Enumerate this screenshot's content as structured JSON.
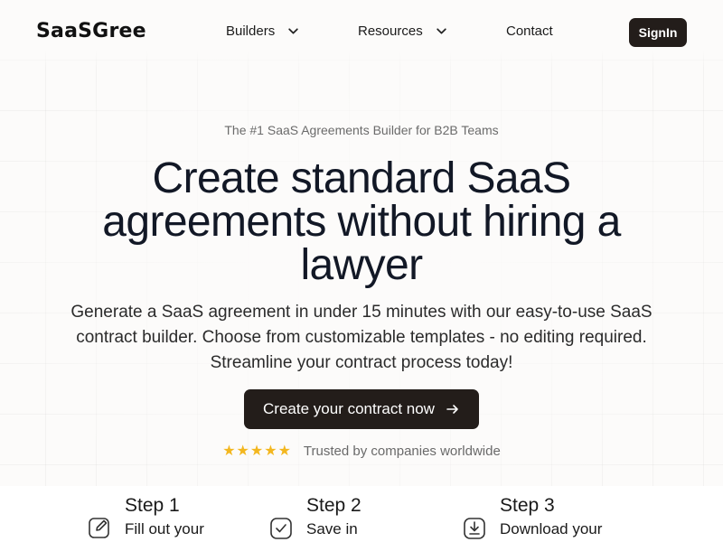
{
  "header": {
    "logo": "SaaSGree",
    "nav": [
      {
        "label": "Builders",
        "has_dropdown": true
      },
      {
        "label": "Resources",
        "has_dropdown": true
      },
      {
        "label": "Contact",
        "has_dropdown": false
      }
    ],
    "signin_label": "SignIn"
  },
  "hero": {
    "eyebrow": "The #1 SaaS Agreements Builder for B2B Teams",
    "headline_lines": [
      "Create standard SaaS",
      "agreements without hiring a",
      "lawyer"
    ],
    "subtext_lines": [
      "Generate a SaaS agreement in under 15 minutes with our easy-to-use SaaS",
      "contract builder. Choose from customizable templates - no editing required.",
      "Streamline your contract process today!"
    ],
    "cta_label": "Create your contract now",
    "rating_stars": 5,
    "trust_text": "Trusted by companies worldwide"
  },
  "steps": [
    {
      "title": "Step 1",
      "description": "Fill out your",
      "icon": "edit-icon"
    },
    {
      "title": "Step 2",
      "description": "Save in",
      "icon": "check-square-icon"
    },
    {
      "title": "Step 3",
      "description": "Download your",
      "icon": "download-icon"
    }
  ],
  "colors": {
    "dark_button": "#231d1a",
    "star": "#f3b71f",
    "background": "#fcfbfa"
  }
}
